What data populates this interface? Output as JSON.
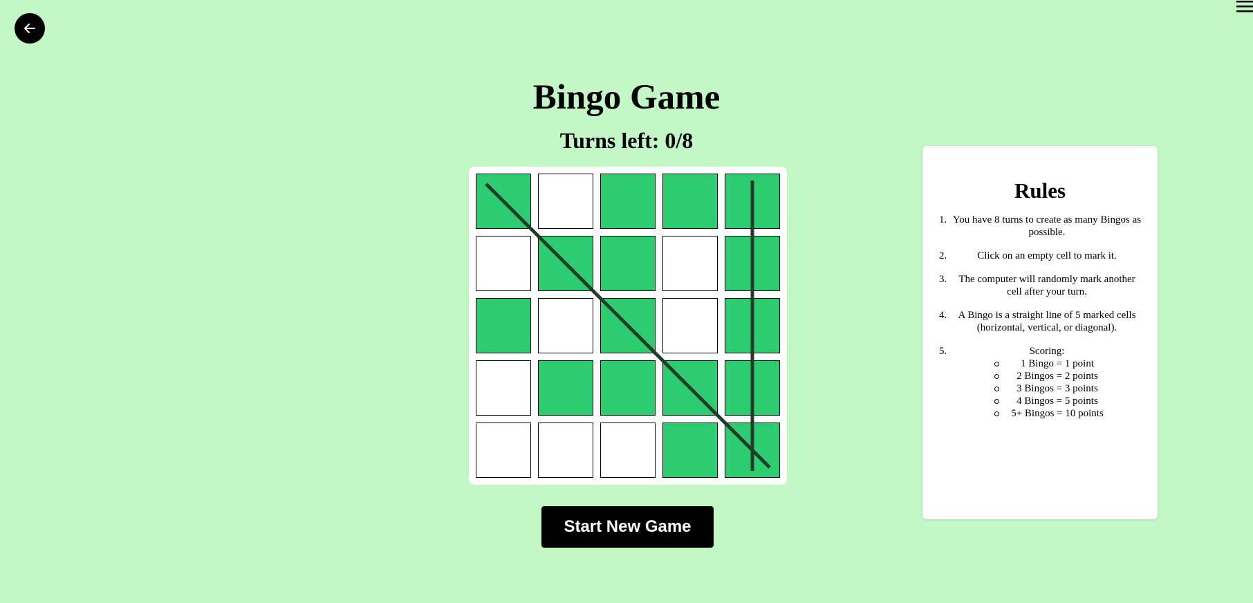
{
  "header": {
    "back_icon": "arrow-left-icon",
    "menu_icon": "hamburger-menu-icon"
  },
  "game": {
    "title": "Bingo Game",
    "turns_label": "Turns left: 0/8",
    "start_button_label": "Start New Game",
    "marked_color": "#2ecc71",
    "board": [
      [
        true,
        false,
        true,
        true,
        true
      ],
      [
        false,
        true,
        true,
        false,
        true
      ],
      [
        true,
        false,
        true,
        false,
        true
      ],
      [
        false,
        true,
        true,
        true,
        true
      ],
      [
        false,
        false,
        false,
        true,
        true
      ]
    ],
    "bingo_lines": [
      "diagonal-main",
      "column-5"
    ]
  },
  "rules": {
    "title": "Rules",
    "items": [
      {
        "num": "1.",
        "text": "You have 8 turns to create as many Bingos as possible."
      },
      {
        "num": "2.",
        "text": "Click on an empty cell to mark it."
      },
      {
        "num": "3.",
        "text": "The computer will randomly mark another cell after your turn."
      },
      {
        "num": "4.",
        "text": "A Bingo is a straight line of 5 marked cells (horizontal, vertical, or diagonal)."
      },
      {
        "num": "5.",
        "text": "Scoring:"
      }
    ],
    "scoring": [
      "1 Bingo = 1 point",
      "2 Bingos = 2 points",
      "3 Bingos = 3 points",
      "4 Bingos = 5 points",
      "5+ Bingos = 10 points"
    ]
  }
}
